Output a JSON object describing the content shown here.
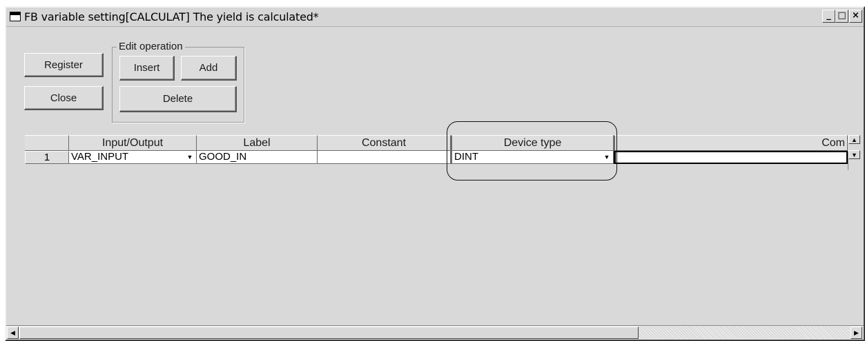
{
  "window": {
    "title": "FB variable setting[CALCULAT]  The yield is calculated*",
    "controls": {
      "minimize": "_",
      "maximize": "□",
      "close": "×"
    }
  },
  "buttons": {
    "register": "Register",
    "close": "Close"
  },
  "edit_operation": {
    "label": "Edit operation",
    "insert": "Insert",
    "add": "Add",
    "delete": "Delete"
  },
  "table": {
    "columns": [
      "",
      "Input/Output",
      "Label",
      "Constant",
      "Device type",
      "Com"
    ],
    "rows": [
      {
        "number": "1",
        "io": "VAR_INPUT",
        "label": "GOOD_IN",
        "constant": "",
        "device_type": "DINT",
        "comment": ""
      }
    ]
  },
  "icons": {
    "dropdown": "▼",
    "scroll_up": "▲",
    "scroll_down": "▼",
    "scroll_left": "◀",
    "scroll_right": "▶"
  }
}
